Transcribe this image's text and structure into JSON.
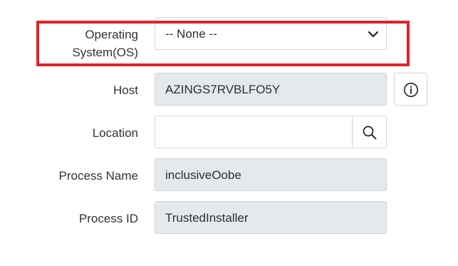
{
  "form": {
    "os": {
      "label": "Operating System(OS)",
      "value": "-- None --"
    },
    "host": {
      "label": "Host",
      "value": "AZINGS7RVBLFO5Y"
    },
    "location": {
      "label": "Location",
      "value": ""
    },
    "process_name": {
      "label": "Process Name",
      "value": "inclusiveOobe"
    },
    "process_id": {
      "label": "Process ID",
      "value": "TrustedInstaller"
    }
  },
  "icons": {
    "os_dropdown": "chevron-down-icon",
    "host_info": "info-icon",
    "location_lookup": "search-icon"
  },
  "colors": {
    "highlight": "#e2222a",
    "readonly_bg": "#e6e9ec",
    "border": "#cfd4d8"
  }
}
